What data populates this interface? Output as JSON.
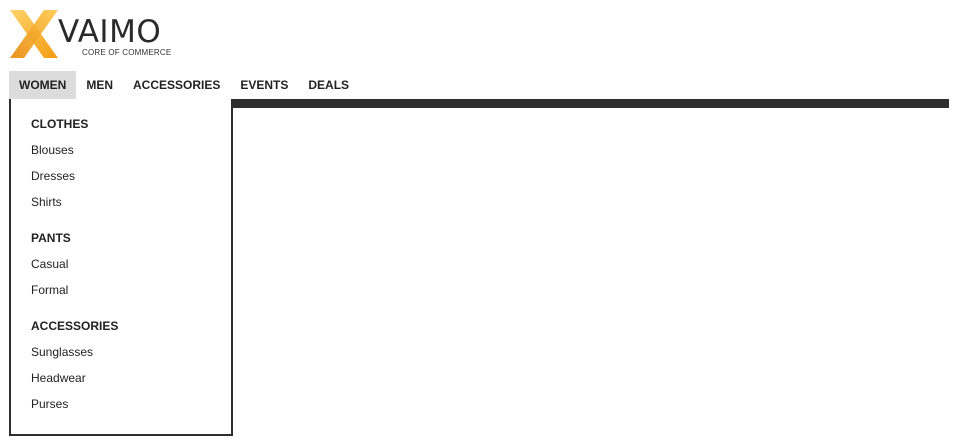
{
  "brand": {
    "name": "VAIMO",
    "tagline": "CORE OF COMMERCE",
    "colors": {
      "accent": "#f5a623",
      "accent_light": "#ffd36a",
      "text": "#2a2a2a"
    }
  },
  "nav": {
    "items": [
      {
        "label": "WOMEN",
        "active": true
      },
      {
        "label": "MEN"
      },
      {
        "label": "ACCESSORIES"
      },
      {
        "label": "EVENTS"
      },
      {
        "label": "DEALS"
      }
    ]
  },
  "dropdown": {
    "groups": [
      {
        "heading": "CLOTHES",
        "links": [
          "Blouses",
          "Dresses",
          "Shirts"
        ]
      },
      {
        "heading": "PANTS",
        "links": [
          "Casual",
          "Formal"
        ]
      },
      {
        "heading": "ACCESSORIES",
        "links": [
          "Sunglasses",
          "Headwear",
          "Purses"
        ]
      }
    ]
  }
}
